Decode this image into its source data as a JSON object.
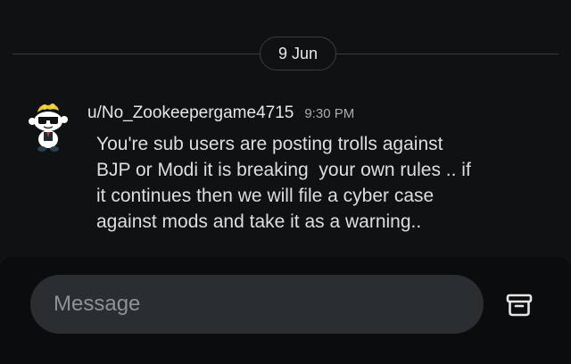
{
  "date_divider": {
    "label": "9 Jun"
  },
  "message": {
    "username": "u/No_Zookeepergame4715",
    "timestamp": "9:30 PM",
    "text": "You're sub users are posting trolls against\nBJP or Modi it is breaking  your own rules .. if\nit continues then we will file a cyber case\nagainst mods and take it as a warning..",
    "avatar_icon": "snoo-avatar-icon"
  },
  "composer": {
    "placeholder": "Message",
    "action_icon": "archive-icon"
  },
  "colors": {
    "background": "#0f1112",
    "input_background": "#2b2e31",
    "divider": "#3a3d40",
    "text": "#e6e6e6",
    "muted_text": "#a9adb1"
  }
}
